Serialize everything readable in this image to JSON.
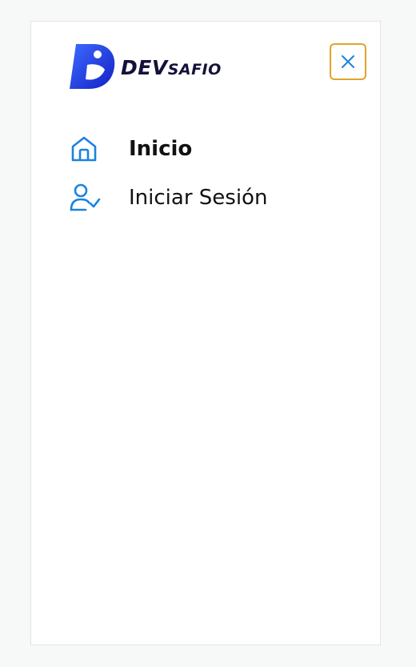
{
  "logo": {
    "text_dev": "DEV",
    "text_safio": "SAFIO",
    "mark_gradient": [
      "#2a57f5",
      "#1727c9"
    ]
  },
  "colors": {
    "accent_icon": "#1a83df",
    "close_border": "#e0a628",
    "close_icon": "#1a83df",
    "logo_text": "#14123a"
  },
  "close_button": {
    "icon": "close-icon"
  },
  "nav": {
    "items": [
      {
        "label": "Inicio",
        "icon": "home-icon",
        "active": true
      },
      {
        "label": "Iniciar Sesión",
        "icon": "user-check-icon",
        "active": false
      }
    ]
  }
}
